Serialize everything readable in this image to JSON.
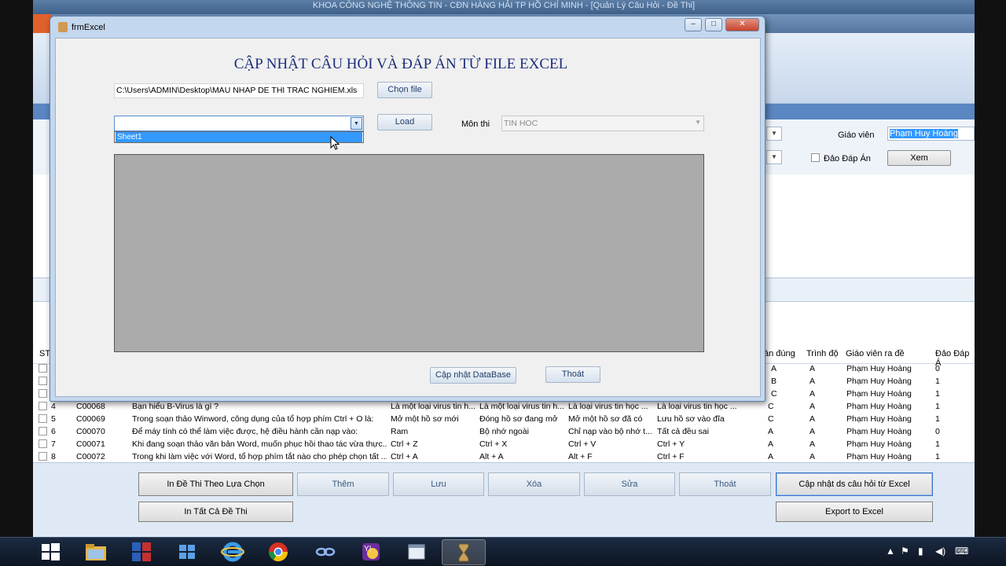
{
  "main_window": {
    "title": "KHOA CÔNG NGHỆ THÔNG TIN - CĐN HÀNG HẢI TP HỒ CHÍ MINH - [Quản Lý Câu Hỏi - Đề Thi]"
  },
  "filters": {
    "teacher_label": "Giáo viên",
    "teacher_value": "Phạm Huy Hoàng",
    "shuffle_label": "Đảo Đáp Án",
    "view_button": "Xem"
  },
  "grid": {
    "headers": [
      "ST",
      "án đúng",
      "Trình độ",
      "Giáo viên ra đề",
      "Đảo Đáp Á"
    ],
    "rows_partial": [
      {
        "correct": "A",
        "level": "A",
        "teacher": "Phạm Huy Hoàng",
        "shuffle": "0"
      },
      {
        "correct": "B",
        "level": "A",
        "teacher": "Phạm Huy Hoàng",
        "shuffle": "1"
      },
      {
        "correct": "C",
        "level": "A",
        "teacher": "Phạm Huy Hoàng",
        "shuffle": "1"
      }
    ],
    "rows": [
      {
        "stt": "4",
        "id": "C00068",
        "question": "Bạn hiểu B-Virus là gì ?",
        "a": "Là một loại virus tin h...",
        "b": "Là một loại virus tin h...",
        "c": "Là loại virus tin học ...",
        "d": "Là loại virus tin học ...",
        "correct": "C",
        "level": "A",
        "teacher": "Phạm Huy Hoàng",
        "shuffle": "1"
      },
      {
        "stt": "5",
        "id": "C00069",
        "question": "Trong soạn thảo Winword, công dụng của tổ hợp phím Ctrl + O là:",
        "a": "Mở một hồ sơ mới",
        "b": "Đóng hồ sơ đang mở",
        "c": "Mở một hồ sơ đã có",
        "d": "Lưu hồ sơ vào đĩa",
        "correct": "C",
        "level": "A",
        "teacher": "Phạm Huy Hoàng",
        "shuffle": "1"
      },
      {
        "stt": "6",
        "id": "C00070",
        "question": "Để máy tính có thể làm việc được, hệ điều hành cần nạp vào:",
        "a": "Ram",
        "b": "Bộ nhớ ngoài",
        "c": "Chỉ nạp vào bộ nhớ t...",
        "d": "Tất cả đều sai",
        "correct": "A",
        "level": "A",
        "teacher": "Phạm Huy Hoàng",
        "shuffle": "0"
      },
      {
        "stt": "7",
        "id": "C00071",
        "question": "Khi đang soạn thảo văn bản Word, muốn phục hồi thao tác vừa thực...",
        "a": "Ctrl + Z",
        "b": "Ctrl + X",
        "c": "Ctrl + V",
        "d": "Ctrl + Y",
        "correct": "A",
        "level": "A",
        "teacher": "Phạm Huy Hoàng",
        "shuffle": "1"
      },
      {
        "stt": "8",
        "id": "C00072",
        "question": "Trong khi làm việc với Word, tổ hợp phím tắt nào cho phép chọn tất ...",
        "a": "Ctrl + A",
        "b": "Alt + A",
        "c": "Alt + F",
        "d": "Ctrl + F",
        "correct": "A",
        "level": "A",
        "teacher": "Phạm Huy Hoàng",
        "shuffle": "1"
      }
    ]
  },
  "bottom_buttons": {
    "print_selected": "In Đề Thi Theo Lựa Chọn",
    "add": "Thêm",
    "save": "Lưu",
    "delete": "Xóa",
    "edit": "Sửa",
    "exit": "Thoát",
    "update_from_excel": "Cập nhật ds câu hỏi từ Excel",
    "print_all": "In Tất Cả Đề Thi",
    "export_excel": "Export to Excel"
  },
  "dialog": {
    "title": "frmExcel",
    "heading": "CẬP NHẬT CÂU HỎI VÀ ĐÁP ÁN TỪ FILE EXCEL",
    "file_path": "C:\\Users\\ADMIN\\Desktop\\MAU NHAP DE THI TRAC NGHIEM.xls",
    "choose_file_button": "Chọn file",
    "sheet_combo_value": "",
    "sheet_options": [
      "Sheet1"
    ],
    "load_button": "Load",
    "subject_label": "Môn thi",
    "subject_value": "TIN HOC",
    "update_db_button": "Cập nhật DataBase",
    "exit_button": "Thoát"
  },
  "taskbar": {
    "items": [
      "start-button",
      "file-explorer",
      "unikey",
      "windows-store",
      "internet-explorer",
      "chrome",
      "network-app",
      "yahoo-messenger",
      "app-window",
      "hourglass-app"
    ],
    "active": "hourglass-app"
  },
  "colors": {
    "dialog_heading": "#1c2e7a",
    "selection": "#3399ff",
    "ribbon_blue": "#5a86c2",
    "close_red": "#c8432c"
  }
}
